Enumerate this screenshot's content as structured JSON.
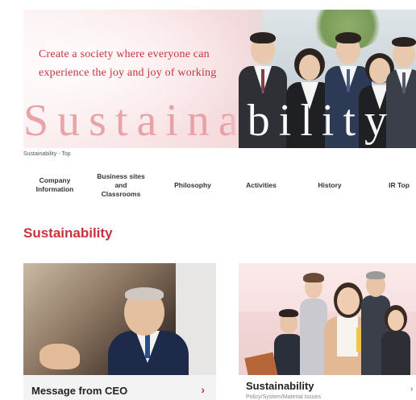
{
  "hero": {
    "tagline_line1": "Create a society where everyone can",
    "tagline_line2": "experience the joy and joy of working",
    "word": "Sustainability"
  },
  "breadcrumb": "Sustainability - Top",
  "nav": [
    {
      "label": "Company Information"
    },
    {
      "label": "Business sites and Classrooms"
    },
    {
      "label": "Philosophy"
    },
    {
      "label": "Activities"
    },
    {
      "label": "History"
    },
    {
      "label": "IR Top"
    }
  ],
  "section_title": "Sustainability",
  "cards": [
    {
      "title": "Message from CEO",
      "arrow": "›"
    },
    {
      "title": "Sustainability",
      "subtitle": "Policy/System/Material Issues",
      "arrow": "›"
    }
  ],
  "colors": {
    "accent": "#c8323e",
    "hero_word": "#e8a3a9"
  }
}
